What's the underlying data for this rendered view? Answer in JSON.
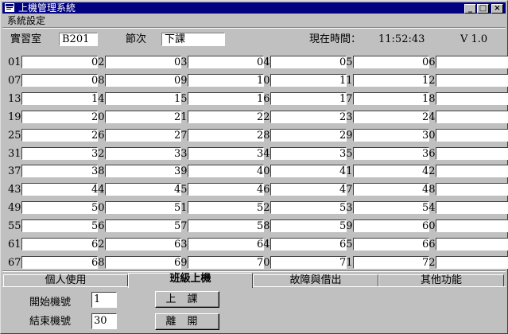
{
  "window": {
    "title": "上機管理系統",
    "caption_buttons": {
      "minimize": "_",
      "maximize": "□",
      "close": "×"
    }
  },
  "menubar": {
    "items": [
      {
        "label": "系統設定"
      }
    ]
  },
  "header": {
    "lab_label": "實習室",
    "lab_value": "B201",
    "period_label": "節次",
    "period_value": "下課",
    "time_label": "現在時間：",
    "time_value": "11:52:43",
    "version": "V 1.0"
  },
  "machines": [
    "01",
    "02",
    "03",
    "04",
    "05",
    "06",
    "07",
    "08",
    "09",
    "10",
    "11",
    "12",
    "13",
    "14",
    "15",
    "16",
    "17",
    "18",
    "19",
    "20",
    "21",
    "22",
    "23",
    "24",
    "25",
    "26",
    "27",
    "28",
    "29",
    "30",
    "31",
    "32",
    "33",
    "34",
    "35",
    "36",
    "37",
    "38",
    "39",
    "40",
    "41",
    "42",
    "43",
    "44",
    "45",
    "46",
    "47",
    "48",
    "49",
    "50",
    "51",
    "52",
    "53",
    "54",
    "55",
    "56",
    "57",
    "58",
    "59",
    "60",
    "61",
    "62",
    "63",
    "64",
    "65",
    "66",
    "67",
    "68",
    "69",
    "70",
    "71",
    "72"
  ],
  "tabs": [
    {
      "label": "個人使用",
      "active": false
    },
    {
      "label": "班級上機",
      "active": true
    },
    {
      "label": "故障與借出",
      "active": false
    },
    {
      "label": "其他功能",
      "active": false
    }
  ],
  "class_panel": {
    "start_label": "開始機號",
    "start_value": "1",
    "end_label": "結束機號",
    "end_value": "30",
    "start_class_button": "上課",
    "leave_button": "離開"
  }
}
